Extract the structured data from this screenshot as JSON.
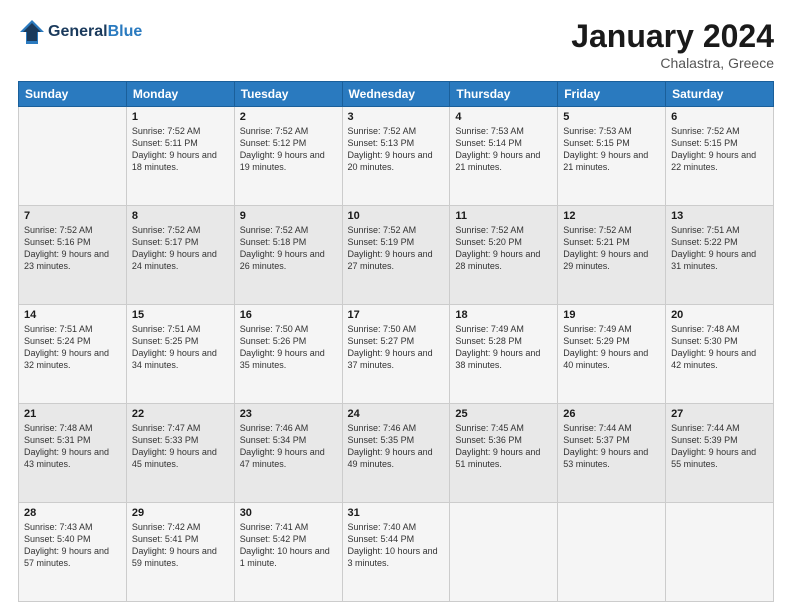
{
  "header": {
    "logo_line1": "General",
    "logo_line2": "Blue",
    "month_title": "January 2024",
    "location": "Chalastra, Greece"
  },
  "weekdays": [
    "Sunday",
    "Monday",
    "Tuesday",
    "Wednesday",
    "Thursday",
    "Friday",
    "Saturday"
  ],
  "weeks": [
    [
      {
        "day": "",
        "sunrise": "",
        "sunset": "",
        "daylight": ""
      },
      {
        "day": "1",
        "sunrise": "Sunrise: 7:52 AM",
        "sunset": "Sunset: 5:11 PM",
        "daylight": "Daylight: 9 hours and 18 minutes."
      },
      {
        "day": "2",
        "sunrise": "Sunrise: 7:52 AM",
        "sunset": "Sunset: 5:12 PM",
        "daylight": "Daylight: 9 hours and 19 minutes."
      },
      {
        "day": "3",
        "sunrise": "Sunrise: 7:52 AM",
        "sunset": "Sunset: 5:13 PM",
        "daylight": "Daylight: 9 hours and 20 minutes."
      },
      {
        "day": "4",
        "sunrise": "Sunrise: 7:53 AM",
        "sunset": "Sunset: 5:14 PM",
        "daylight": "Daylight: 9 hours and 21 minutes."
      },
      {
        "day": "5",
        "sunrise": "Sunrise: 7:53 AM",
        "sunset": "Sunset: 5:15 PM",
        "daylight": "Daylight: 9 hours and 21 minutes."
      },
      {
        "day": "6",
        "sunrise": "Sunrise: 7:52 AM",
        "sunset": "Sunset: 5:15 PM",
        "daylight": "Daylight: 9 hours and 22 minutes."
      }
    ],
    [
      {
        "day": "7",
        "sunrise": "Sunrise: 7:52 AM",
        "sunset": "Sunset: 5:16 PM",
        "daylight": "Daylight: 9 hours and 23 minutes."
      },
      {
        "day": "8",
        "sunrise": "Sunrise: 7:52 AM",
        "sunset": "Sunset: 5:17 PM",
        "daylight": "Daylight: 9 hours and 24 minutes."
      },
      {
        "day": "9",
        "sunrise": "Sunrise: 7:52 AM",
        "sunset": "Sunset: 5:18 PM",
        "daylight": "Daylight: 9 hours and 26 minutes."
      },
      {
        "day": "10",
        "sunrise": "Sunrise: 7:52 AM",
        "sunset": "Sunset: 5:19 PM",
        "daylight": "Daylight: 9 hours and 27 minutes."
      },
      {
        "day": "11",
        "sunrise": "Sunrise: 7:52 AM",
        "sunset": "Sunset: 5:20 PM",
        "daylight": "Daylight: 9 hours and 28 minutes."
      },
      {
        "day": "12",
        "sunrise": "Sunrise: 7:52 AM",
        "sunset": "Sunset: 5:21 PM",
        "daylight": "Daylight: 9 hours and 29 minutes."
      },
      {
        "day": "13",
        "sunrise": "Sunrise: 7:51 AM",
        "sunset": "Sunset: 5:22 PM",
        "daylight": "Daylight: 9 hours and 31 minutes."
      }
    ],
    [
      {
        "day": "14",
        "sunrise": "Sunrise: 7:51 AM",
        "sunset": "Sunset: 5:24 PM",
        "daylight": "Daylight: 9 hours and 32 minutes."
      },
      {
        "day": "15",
        "sunrise": "Sunrise: 7:51 AM",
        "sunset": "Sunset: 5:25 PM",
        "daylight": "Daylight: 9 hours and 34 minutes."
      },
      {
        "day": "16",
        "sunrise": "Sunrise: 7:50 AM",
        "sunset": "Sunset: 5:26 PM",
        "daylight": "Daylight: 9 hours and 35 minutes."
      },
      {
        "day": "17",
        "sunrise": "Sunrise: 7:50 AM",
        "sunset": "Sunset: 5:27 PM",
        "daylight": "Daylight: 9 hours and 37 minutes."
      },
      {
        "day": "18",
        "sunrise": "Sunrise: 7:49 AM",
        "sunset": "Sunset: 5:28 PM",
        "daylight": "Daylight: 9 hours and 38 minutes."
      },
      {
        "day": "19",
        "sunrise": "Sunrise: 7:49 AM",
        "sunset": "Sunset: 5:29 PM",
        "daylight": "Daylight: 9 hours and 40 minutes."
      },
      {
        "day": "20",
        "sunrise": "Sunrise: 7:48 AM",
        "sunset": "Sunset: 5:30 PM",
        "daylight": "Daylight: 9 hours and 42 minutes."
      }
    ],
    [
      {
        "day": "21",
        "sunrise": "Sunrise: 7:48 AM",
        "sunset": "Sunset: 5:31 PM",
        "daylight": "Daylight: 9 hours and 43 minutes."
      },
      {
        "day": "22",
        "sunrise": "Sunrise: 7:47 AM",
        "sunset": "Sunset: 5:33 PM",
        "daylight": "Daylight: 9 hours and 45 minutes."
      },
      {
        "day": "23",
        "sunrise": "Sunrise: 7:46 AM",
        "sunset": "Sunset: 5:34 PM",
        "daylight": "Daylight: 9 hours and 47 minutes."
      },
      {
        "day": "24",
        "sunrise": "Sunrise: 7:46 AM",
        "sunset": "Sunset: 5:35 PM",
        "daylight": "Daylight: 9 hours and 49 minutes."
      },
      {
        "day": "25",
        "sunrise": "Sunrise: 7:45 AM",
        "sunset": "Sunset: 5:36 PM",
        "daylight": "Daylight: 9 hours and 51 minutes."
      },
      {
        "day": "26",
        "sunrise": "Sunrise: 7:44 AM",
        "sunset": "Sunset: 5:37 PM",
        "daylight": "Daylight: 9 hours and 53 minutes."
      },
      {
        "day": "27",
        "sunrise": "Sunrise: 7:44 AM",
        "sunset": "Sunset: 5:39 PM",
        "daylight": "Daylight: 9 hours and 55 minutes."
      }
    ],
    [
      {
        "day": "28",
        "sunrise": "Sunrise: 7:43 AM",
        "sunset": "Sunset: 5:40 PM",
        "daylight": "Daylight: 9 hours and 57 minutes."
      },
      {
        "day": "29",
        "sunrise": "Sunrise: 7:42 AM",
        "sunset": "Sunset: 5:41 PM",
        "daylight": "Daylight: 9 hours and 59 minutes."
      },
      {
        "day": "30",
        "sunrise": "Sunrise: 7:41 AM",
        "sunset": "Sunset: 5:42 PM",
        "daylight": "Daylight: 10 hours and 1 minute."
      },
      {
        "day": "31",
        "sunrise": "Sunrise: 7:40 AM",
        "sunset": "Sunset: 5:44 PM",
        "daylight": "Daylight: 10 hours and 3 minutes."
      },
      {
        "day": "",
        "sunrise": "",
        "sunset": "",
        "daylight": ""
      },
      {
        "day": "",
        "sunrise": "",
        "sunset": "",
        "daylight": ""
      },
      {
        "day": "",
        "sunrise": "",
        "sunset": "",
        "daylight": ""
      }
    ]
  ]
}
